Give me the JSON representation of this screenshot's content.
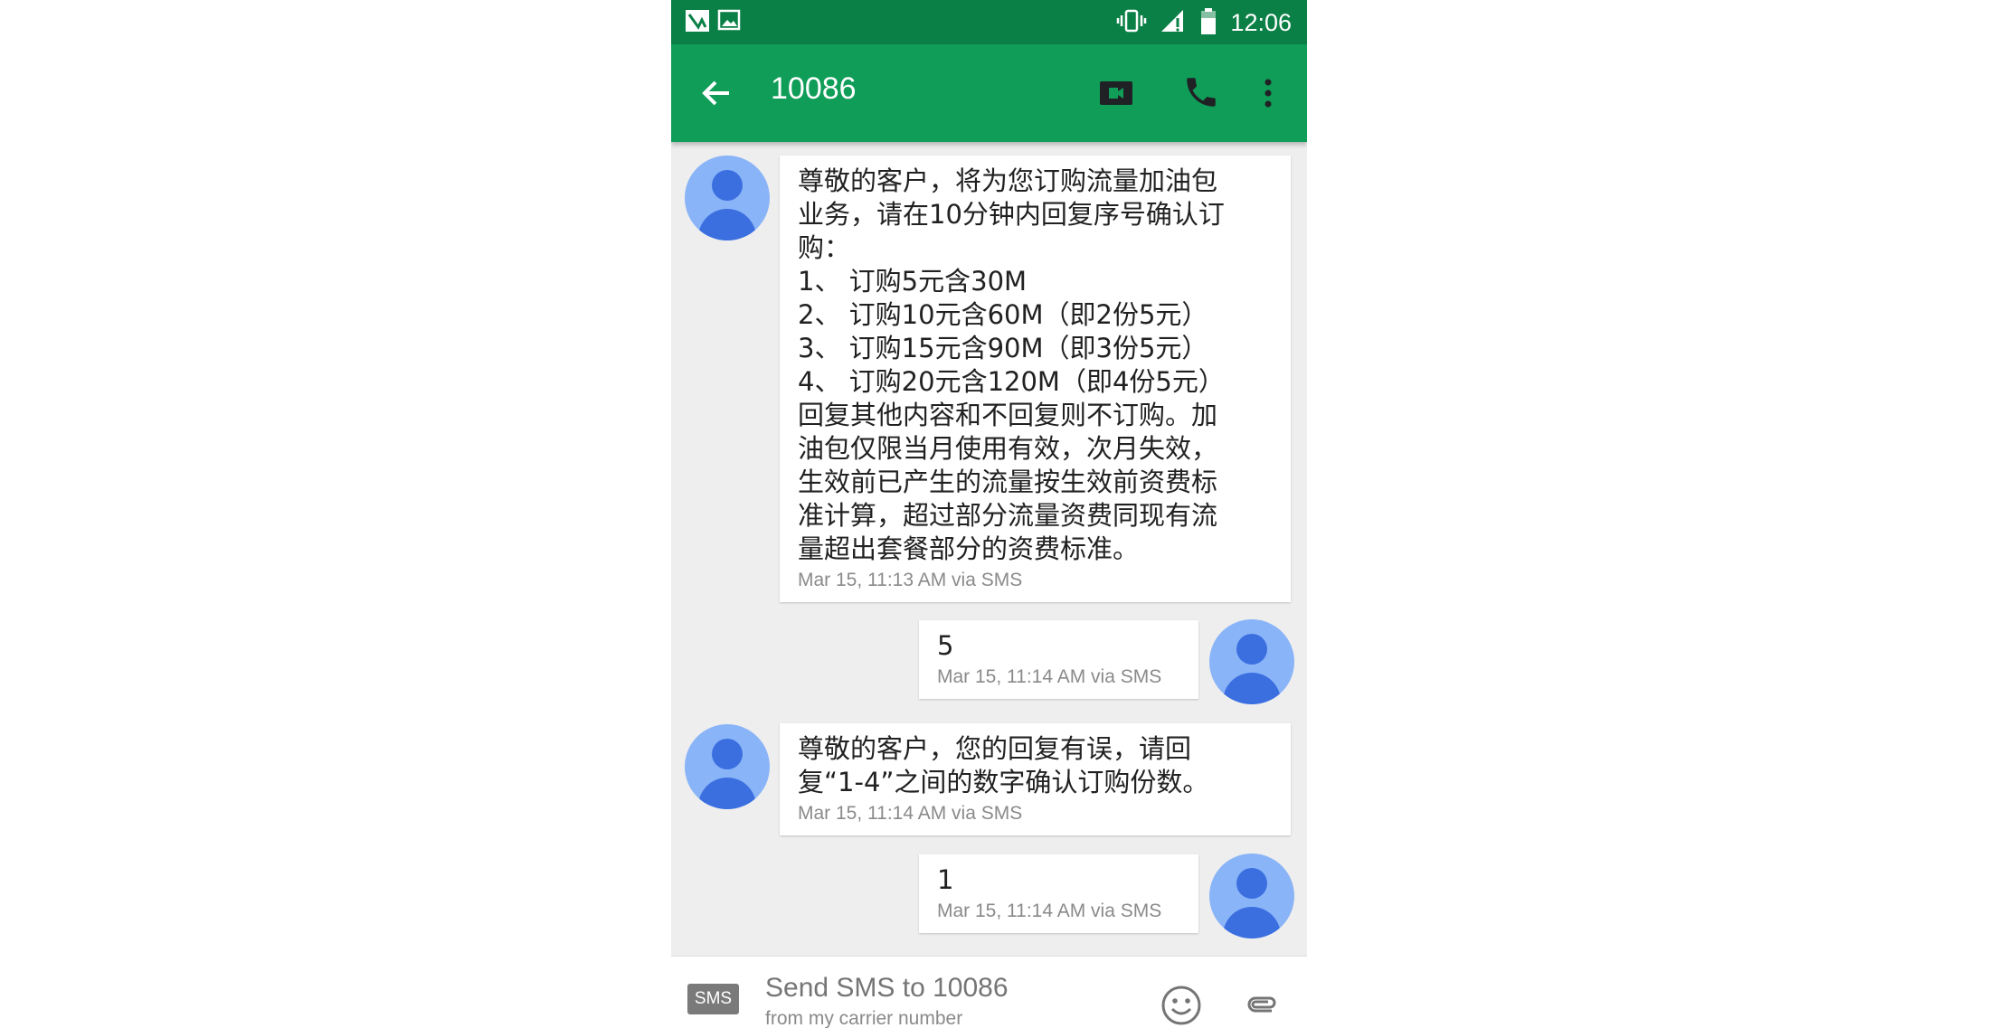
{
  "status_bar": {
    "time": "12:06",
    "icons": [
      "app-notification-icon",
      "image-notification-icon",
      "vibrate-icon",
      "signal-icon",
      "battery-icon"
    ]
  },
  "app_bar": {
    "title": "10086",
    "actions": [
      "back-arrow-icon",
      "video-call-icon",
      "phone-icon",
      "more-vert-icon"
    ]
  },
  "messages": [
    {
      "direction": "incoming",
      "text": "尊敬的客户，将为您订购流量加油包\n业务，请在10分钟内回复序号确认订\n购：\n1、 订购5元含30M\n2、 订购10元含60M（即2份5元）\n3、 订购15元含90M（即3份5元）\n4、 订购20元含120M（即4份5元）\n回复其他内容和不回复则不订购。加\n油包仅限当月使用有效，次月失效，\n生效前已产生的流量按生效前资费标\n准计算，超过部分流量资费同现有流\n量超出套餐部分的资费标准。",
      "meta": "Mar 15, 11:13 AM via SMS"
    },
    {
      "direction": "outgoing",
      "text": "5",
      "meta": "Mar 15, 11:14 AM via SMS"
    },
    {
      "direction": "incoming",
      "text": "尊敬的客户，您的回复有误，请回\n复“1-4”之间的数字确认订购份数。",
      "meta": "Mar 15, 11:14 AM via SMS"
    },
    {
      "direction": "outgoing",
      "text": "1",
      "meta": "Mar 15, 11:14 AM via SMS"
    }
  ],
  "composer": {
    "badge": "SMS",
    "placeholder": "Send SMS to 10086",
    "subtext": "from my carrier number",
    "icons": [
      "emoji-icon",
      "attach-icon"
    ]
  },
  "colors": {
    "status_bar": "#0a8046",
    "app_bar": "#0f9d58",
    "avatar_bg": "#8ab4f8",
    "avatar_fg": "#3b6fe0",
    "thread_bg": "#eeeeee"
  }
}
